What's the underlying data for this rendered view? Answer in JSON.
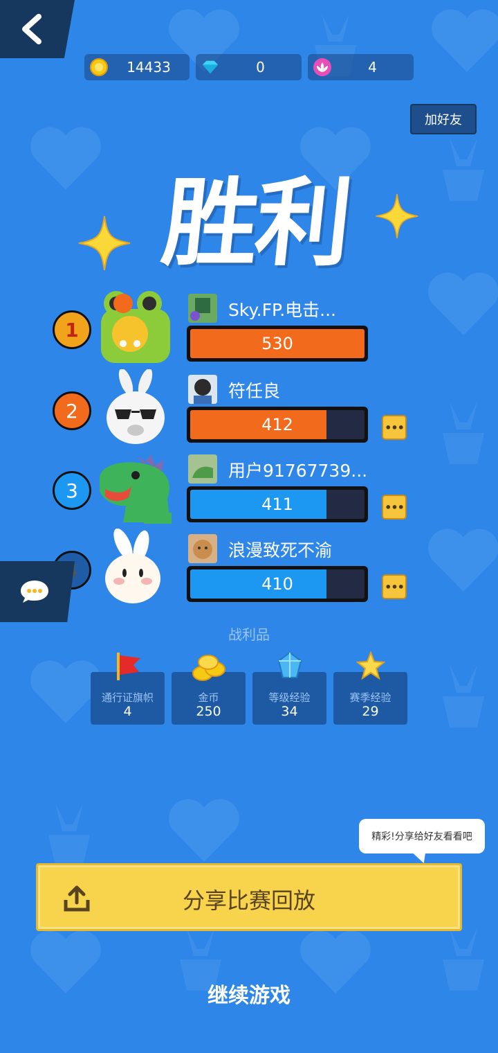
{
  "resources": [
    {
      "icon": "gold-coin-icon",
      "value": "14433"
    },
    {
      "icon": "diamond-icon",
      "value": "0"
    },
    {
      "icon": "lotus-icon",
      "value": "4"
    }
  ],
  "header": {
    "add_friend_label": "加好友"
  },
  "result_title": "胜利",
  "players": [
    {
      "rank": "1",
      "name": "Sky.FP.电击...",
      "score": "530",
      "fill_fraction": 1.0,
      "bar_color": "#F26A1B",
      "avatar": "frog-avatar"
    },
    {
      "rank": "2",
      "name": "符任良",
      "score": "412",
      "fill_fraction": 0.78,
      "bar_color": "#F26A1B",
      "avatar": "white-rabbit-sunglasses-avatar"
    },
    {
      "rank": "3",
      "name": "用户91767739...",
      "score": "411",
      "fill_fraction": 0.78,
      "bar_color": "#1C98F2",
      "avatar": "green-dinosaur-avatar"
    },
    {
      "rank": "4",
      "name": "浪漫致死不渝",
      "score": "410",
      "fill_fraction": 0.78,
      "bar_color": "#1C98F2",
      "avatar": "white-rabbit-avatar"
    }
  ],
  "loot": {
    "title": "战利品",
    "items": [
      {
        "label": "通行证旗帜",
        "value": "4",
        "icon": "red-flag-icon"
      },
      {
        "label": "金币",
        "value": "250",
        "icon": "gold-coins-icon"
      },
      {
        "label": "等级经验",
        "value": "34",
        "icon": "blue-crystal-icon"
      },
      {
        "label": "赛季经验",
        "value": "29",
        "icon": "star-icon"
      }
    ]
  },
  "share": {
    "tooltip": "精彩!分享给好友看看吧",
    "label": "分享比赛回放"
  },
  "continue_label": "继续游戏",
  "colors": {
    "background": "#2E86E8",
    "orange": "#F26A1B",
    "blue": "#1C98F2",
    "yellow": "#F7D44C"
  }
}
